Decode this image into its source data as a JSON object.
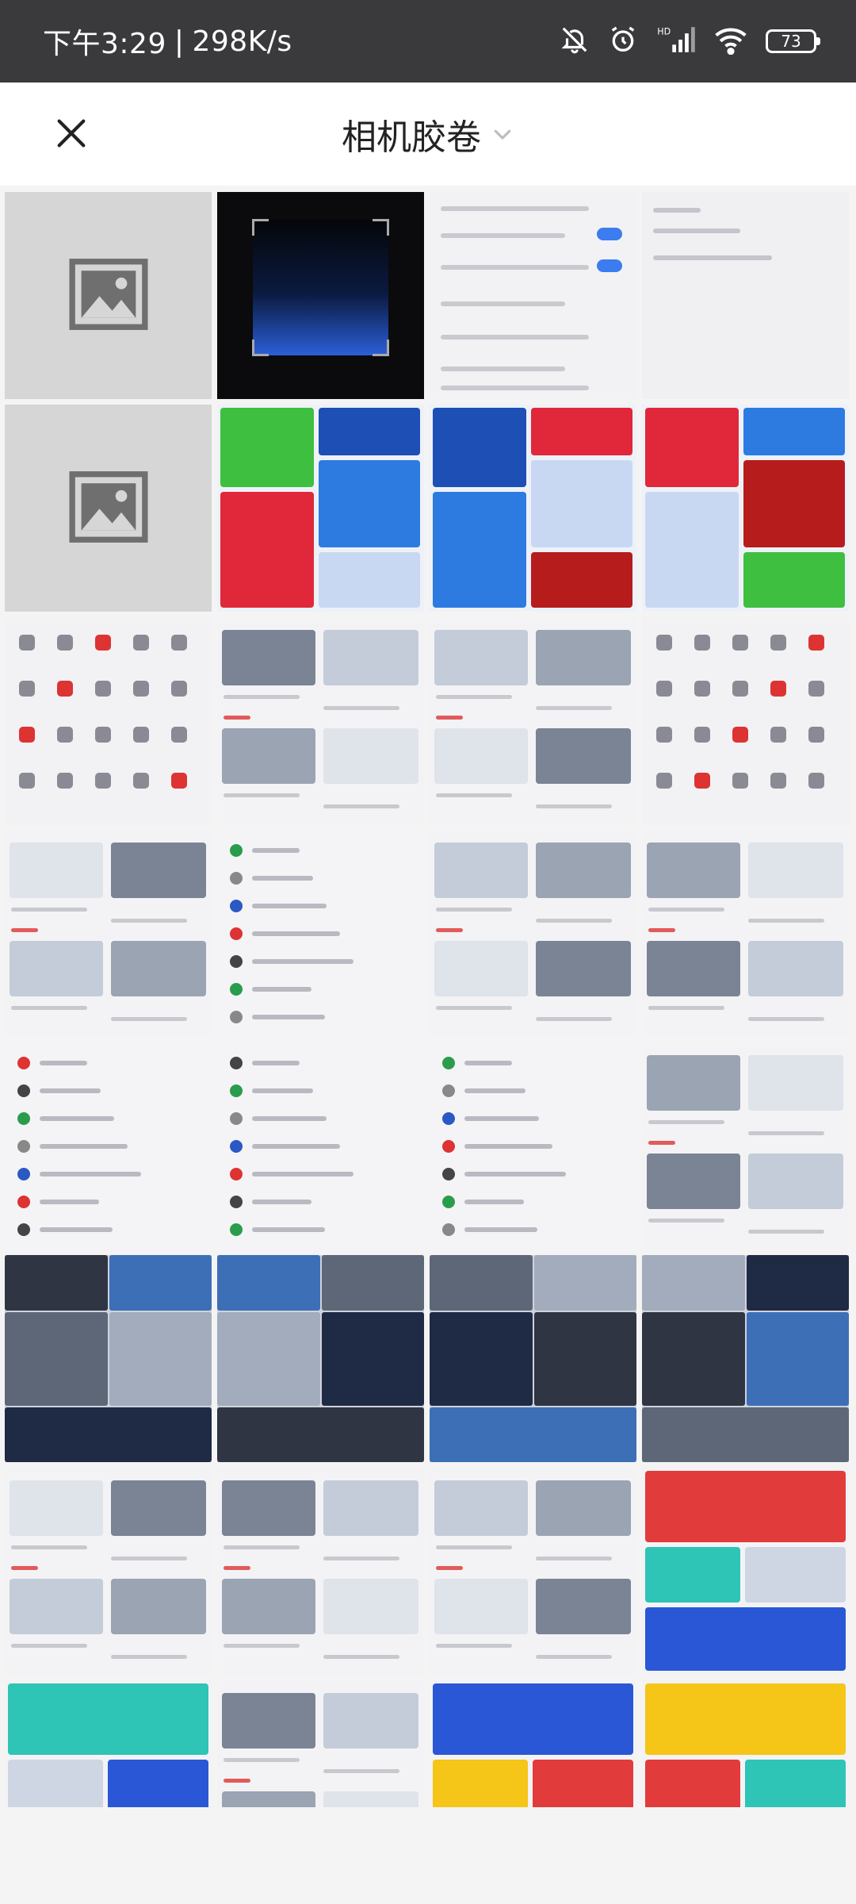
{
  "status_bar": {
    "time": "下午3:29",
    "speed": "298K/s",
    "battery": "73",
    "icons": [
      "bell-off-icon",
      "alarm-icon",
      "hd-signal-icon",
      "wifi-icon",
      "battery-icon"
    ]
  },
  "header": {
    "title": "相机胶卷",
    "close_icon": "close-icon",
    "dropdown_icon": "chevron-down-icon"
  },
  "thumbnails": [
    {
      "style": "placeholder"
    },
    {
      "style": "dark"
    },
    {
      "style": "settings"
    },
    {
      "style": "light"
    },
    {
      "style": "placeholder"
    },
    {
      "style": "merch"
    },
    {
      "style": "merch"
    },
    {
      "style": "merch"
    },
    {
      "style": "icons"
    },
    {
      "style": "cars"
    },
    {
      "style": "cars"
    },
    {
      "style": "icons"
    },
    {
      "style": "cars"
    },
    {
      "style": "list"
    },
    {
      "style": "cars"
    },
    {
      "style": "cars"
    },
    {
      "style": "list"
    },
    {
      "style": "list"
    },
    {
      "style": "list"
    },
    {
      "style": "cars"
    },
    {
      "style": "media"
    },
    {
      "style": "media"
    },
    {
      "style": "media"
    },
    {
      "style": "media"
    },
    {
      "style": "cars"
    },
    {
      "style": "cars"
    },
    {
      "style": "cars"
    },
    {
      "style": "promo"
    },
    {
      "style": "promo"
    },
    {
      "style": "cars"
    },
    {
      "style": "promo"
    },
    {
      "style": "promo"
    }
  ],
  "colors": {
    "status_bg": "#3a3a3c",
    "accent_blue": "#3b7cf0",
    "accent_red": "#e23b3b"
  }
}
